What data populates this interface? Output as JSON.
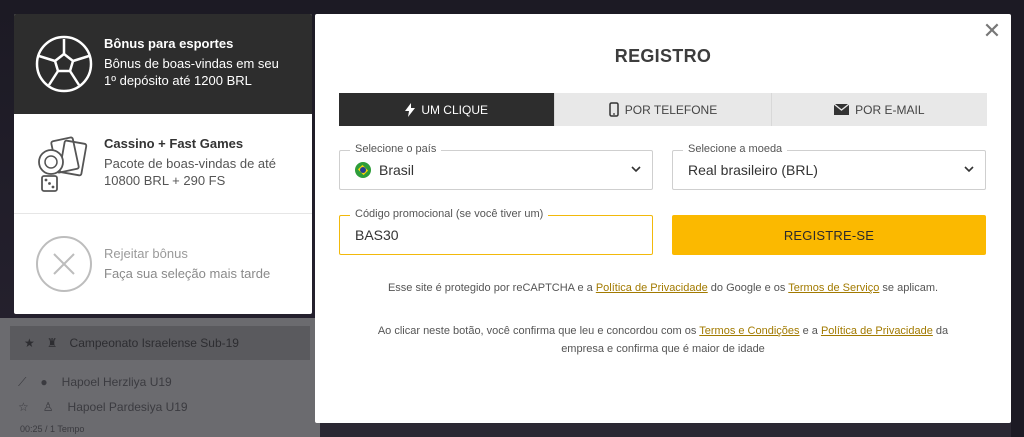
{
  "background": {
    "league_row": "Campeonato Israelense Sub-19",
    "teams": [
      "Hapoel Herzliya U19",
      "Hapoel Pardesiya U19"
    ],
    "footer": "00:25 / 1 Tempo"
  },
  "bonuses": [
    {
      "icon": "soccer-ball-icon",
      "title": "Bônus para esportes",
      "desc_line1": "Bônus de boas-vindas em seu",
      "desc_line2": "1º depósito até 1200 BRL"
    },
    {
      "icon": "casino-chips-dice-icon",
      "title": "Cassino + Fast Games",
      "desc_line1": "Pacote de boas-vindas de até",
      "desc_line2": "10800 BRL + 290 FS"
    },
    {
      "icon": "reject-x-icon",
      "title": "Rejeitar bônus",
      "desc_line1": "Faça sua seleção mais tarde",
      "desc_line2": ""
    }
  ],
  "modal": {
    "close": "✕",
    "title": "REGISTRO",
    "tabs": [
      {
        "label": "UM CLIQUE",
        "icon": "lightning-icon",
        "active": true
      },
      {
        "label": "POR TELEFONE",
        "icon": "phone-icon",
        "active": false
      },
      {
        "label": "POR E-MAIL",
        "icon": "envelope-icon",
        "active": false
      }
    ],
    "country": {
      "label": "Selecione o país",
      "value": "Brasil"
    },
    "currency": {
      "label": "Selecione a moeda",
      "value": "Real brasileiro (BRL)"
    },
    "promo": {
      "label": "Código promocional (se você tiver um)",
      "value": "BAS30"
    },
    "register_button": "REGISTRE-SE",
    "recaptcha": {
      "t1": "Esse site é protegido por reCAPTCHA e a ",
      "link1": "Política de Privacidade",
      "t2": " do Google e os ",
      "link2": "Termos de Serviço",
      "t3": " se aplicam."
    },
    "consent": {
      "t1": "Ao clicar neste botão, você confirma que leu e concordou com os ",
      "link1": "Termos e Condições",
      "t2": " e a ",
      "link2": "Política de Privacidade",
      "t3": " da",
      "t4": "empresa e confirma que é maior de idade"
    }
  },
  "colors": {
    "accent": "#fbb900",
    "active_tab": "#2d2d2d",
    "link": "#a27a00"
  }
}
